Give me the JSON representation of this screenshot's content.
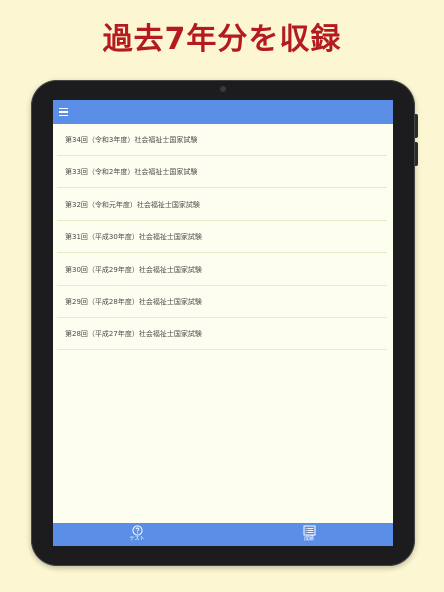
{
  "headline": "過去7年分を収録",
  "navbar": {
    "menu_icon": "hamburger-menu-icon"
  },
  "exam_list": [
    {
      "label": "第34回（令和3年度）社会福祉士国家試験"
    },
    {
      "label": "第33回（令和2年度）社会福祉士国家試験"
    },
    {
      "label": "第32回（令和元年度）社会福祉士国家試験"
    },
    {
      "label": "第31回（平成30年度）社会福祉士国家試験"
    },
    {
      "label": "第30回（平成29年度）社会福祉士国家試験"
    },
    {
      "label": "第29回（平成28年度）社会福祉士国家試験"
    },
    {
      "label": "第28回（平成27年度）社会福祉士国家試験"
    }
  ],
  "tabbar": {
    "tabs": [
      {
        "label": "テスト",
        "icon": "question-circle-icon"
      },
      {
        "label": "成績",
        "icon": "list-icon"
      }
    ]
  },
  "colors": {
    "page_background": "#FCF6D2",
    "headline": "#B51A1F",
    "bar": "#5B8EE6",
    "screen_background": "#FEFEF0"
  }
}
